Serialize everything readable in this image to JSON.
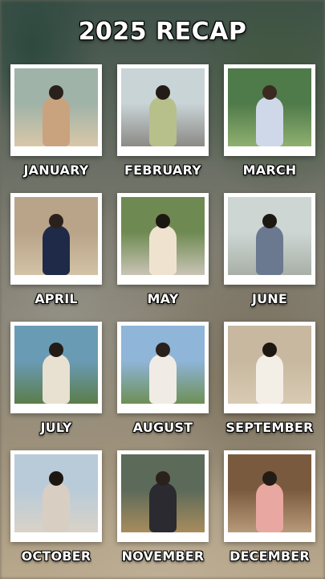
{
  "title": "2025 RECAP",
  "months": [
    {
      "label": "JANUARY",
      "scene": [
        "#9fb3a8",
        "#d9c7a8"
      ],
      "outfit": "#c9a37e",
      "hair": "#2a211c"
    },
    {
      "label": "FEBRUARY",
      "scene": [
        "#c9d4d6",
        "#8b8a86"
      ],
      "outfit": "#b7c08a",
      "hair": "#231b16"
    },
    {
      "label": "MARCH",
      "scene": [
        "#4f7a4a",
        "#8fb070"
      ],
      "outfit": "#cfd8e8",
      "hair": "#3a2a20"
    },
    {
      "label": "APRIL",
      "scene": [
        "#b9a489",
        "#d2c2a6"
      ],
      "outfit": "#1f2a48",
      "hair": "#2a211c"
    },
    {
      "label": "MAY",
      "scene": [
        "#6e8a52",
        "#c9c4b5"
      ],
      "outfit": "#efe3cf",
      "hair": "#1d1712"
    },
    {
      "label": "JUNE",
      "scene": [
        "#cdd6d3",
        "#a8b0a7"
      ],
      "outfit": "#6a7890",
      "hair": "#1d1712"
    },
    {
      "label": "JULY",
      "scene": [
        "#6a9bb5",
        "#5b7d4a"
      ],
      "outfit": "#e8e0d0",
      "hair": "#231b16"
    },
    {
      "label": "AUGUST",
      "scene": [
        "#8fb5d9",
        "#6e8f55"
      ],
      "outfit": "#f0ebe4",
      "hair": "#2a211c"
    },
    {
      "label": "SEPTEMBER",
      "scene": [
        "#c7b89f",
        "#d8cbb3"
      ],
      "outfit": "#f4efe6",
      "hair": "#1d1712"
    },
    {
      "label": "OCTOBER",
      "scene": [
        "#b9cbd9",
        "#d9d3c8"
      ],
      "outfit": "#d8cfc2",
      "hair": "#1d1712"
    },
    {
      "label": "NOVEMBER",
      "scene": [
        "#5c6a5a",
        "#a88c5c"
      ],
      "outfit": "#2a2a30",
      "hair": "#2a211c"
    },
    {
      "label": "DECEMBER",
      "scene": [
        "#7a5a3e",
        "#b79a7a"
      ],
      "outfit": "#e8a7a0",
      "hair": "#231b16"
    }
  ]
}
